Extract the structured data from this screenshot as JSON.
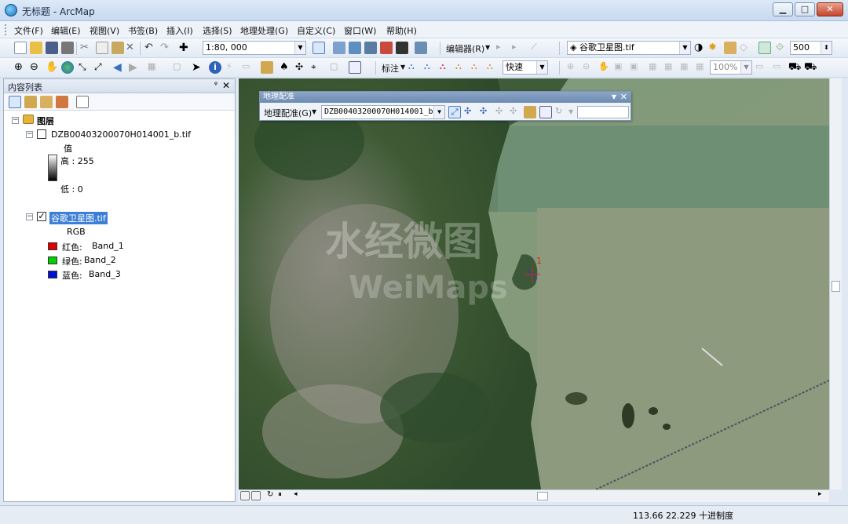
{
  "window": {
    "title": "无标题 - ArcMap",
    "minimize": "▁",
    "maximize": "□",
    "close": "✕"
  },
  "menu": [
    "文件(F)",
    "编辑(E)",
    "视图(V)",
    "书签(B)",
    "插入(I)",
    "选择(S)",
    "地理处理(G)",
    "自定义(C)",
    "窗口(W)",
    "帮助(H)"
  ],
  "toolbar1": {
    "scale": "1:80, 000",
    "editor_label": "编辑器(R)",
    "layer_combo": "谷歌卫星图.tif",
    "resolution": "500"
  },
  "toolbar2": {
    "label_menu": "标注",
    "render_quality": "快速",
    "zoom_percent": "100%"
  },
  "toc": {
    "title": "内容列表",
    "pin": "ᵠ",
    "close": "✕",
    "group_name": "图层",
    "layer1": {
      "name": "DZB00403200070H014001_b.tif",
      "value_label": "值",
      "high": "高 : 255",
      "low": "低 : 0"
    },
    "layer2": {
      "name": "谷歌卫星图.tif",
      "mode": "RGB",
      "bands": [
        {
          "label": "红色:",
          "band": "Band_1",
          "color": "#e00000"
        },
        {
          "label": "绿色:",
          "band": "Band_2",
          "color": "#00d000"
        },
        {
          "label": "蓝色:",
          "band": "Band_3",
          "color": "#0010d0"
        }
      ]
    }
  },
  "georef": {
    "title": "地理配准",
    "menu_label": "地理配准(G)",
    "layer_combo": "DZB00403200070H014001_b.ti",
    "close": "✕"
  },
  "map": {
    "watermark_cn": "水经微图",
    "watermark_en": "WeiMaps",
    "control_point_label": "1"
  },
  "status": {
    "coords": "113.66  22.229 十进制度"
  }
}
